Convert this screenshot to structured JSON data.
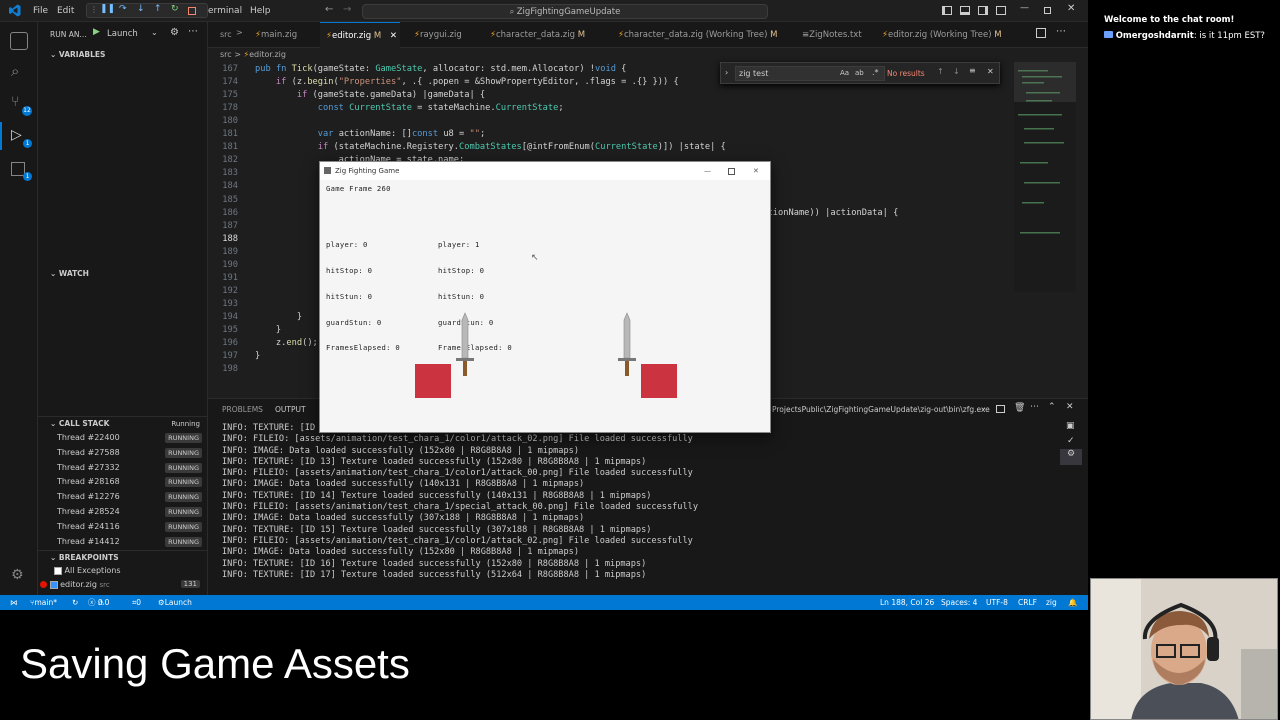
{
  "titlebar": {
    "menus": [
      "File",
      "Edit",
      "erminal",
      "Help"
    ],
    "search": "ZigFightingGameUpdate"
  },
  "sidebar": {
    "run_label": "RUN AN...",
    "launch_config": "Launch",
    "variables": "VARIABLES",
    "watch": "WATCH",
    "call_stack": "CALL STACK",
    "call_stack_status": "Running",
    "threads": [
      {
        "name": "Thread #22400",
        "state": "RUNNING"
      },
      {
        "name": "Thread #27588",
        "state": "RUNNING"
      },
      {
        "name": "Thread #27332",
        "state": "RUNNING"
      },
      {
        "name": "Thread #28168",
        "state": "RUNNING"
      },
      {
        "name": "Thread #12276",
        "state": "RUNNING"
      },
      {
        "name": "Thread #28524",
        "state": "RUNNING"
      },
      {
        "name": "Thread #24116",
        "state": "RUNNING"
      },
      {
        "name": "Thread #14412",
        "state": "RUNNING"
      }
    ],
    "breakpoints": "BREAKPOINTS",
    "all_exceptions": "All Exceptions",
    "bp_file": "editor.zig",
    "bp_folder": "src",
    "bp_line": "131"
  },
  "tabs": [
    {
      "label": "main.zig",
      "mod": ""
    },
    {
      "label": "editor.zig",
      "mod": "M"
    },
    {
      "label": "raygui.zig",
      "mod": ""
    },
    {
      "label": "character_data.zig",
      "mod": "M"
    },
    {
      "label": "character_data.zig (Working Tree)",
      "mod": "M"
    },
    {
      "label": "ZigNotes.txt",
      "mod": ""
    },
    {
      "label": "editor.zig (Working Tree)",
      "mod": "M"
    }
  ],
  "breadcrumb": {
    "folder": "src",
    "file": "editor.zig"
  },
  "find": {
    "query": "zig test",
    "result": "No results"
  },
  "editor": {
    "lines": [
      {
        "n": "167",
        "code": "pub fn Tick(gameState: GameState, allocator: std.mem.Allocator) !void {"
      },
      {
        "n": "174",
        "code": "    if (z.begin(\"Properties\", .{ .popen = &ShowPropertyEditor, .flags = .{} })) {"
      },
      {
        "n": "175",
        "code": "        if (gameState.gameData) |gameData| {"
      },
      {
        "n": "178",
        "code": "            const CurrentState = stateMachine.CurrentState;"
      },
      {
        "n": "180",
        "code": ""
      },
      {
        "n": "181",
        "code": "            var actionName: []const u8 = \"\";"
      },
      {
        "n": "181",
        "code": "            if (stateMachine.Registery.CombatStates[@intFromEnum(CurrentState)]) |state| {"
      },
      {
        "n": "182",
        "code": "                actionName = state.name;"
      },
      {
        "n": "183",
        "code": ""
      },
      {
        "n": "184",
        "code": ""
      },
      {
        "n": "185",
        "code": ""
      },
      {
        "n": "186",
        "code": "                                                                                   ems[entity], actionName)) |actionData| {"
      },
      {
        "n": "187",
        "code": ""
      },
      {
        "n": "188",
        "code": ""
      },
      {
        "n": "189",
        "code": ""
      },
      {
        "n": "190",
        "code": ""
      },
      {
        "n": "191",
        "code": ""
      },
      {
        "n": "192",
        "code": "                                                                                   llocator);"
      },
      {
        "n": "193",
        "code": ""
      },
      {
        "n": "194",
        "code": "        }"
      },
      {
        "n": "195",
        "code": "    }"
      },
      {
        "n": "196",
        "code": "    z.end();"
      },
      {
        "n": "197",
        "code": "}"
      },
      {
        "n": "198",
        "code": ""
      }
    ]
  },
  "panel": {
    "tabs": [
      "PROBLEMS",
      "OUTPUT"
    ],
    "path": "ProjectsPublic\\ZigFightingGameUpdate\\zig-out\\bin\\zfg.exe",
    "output": [
      "INFO: TEXTURE: [ID",
      "INFO: FILEIO: [assets/animation/test_chara_1/color1/attack_02.png] File loaded successfully",
      "INFO: IMAGE: Data loaded successfully (152x80 | R8G8B8A8 | 1 mipmaps)",
      "INFO: TEXTURE: [ID 13] Texture loaded successfully (152x80 | R8G8B8A8 | 1 mipmaps)",
      "INFO: FILEIO: [assets/animation/test_chara_1/color1/attack_00.png] File loaded successfully",
      "INFO: IMAGE: Data loaded successfully (140x131 | R8G8B8A8 | 1 mipmaps)",
      "INFO: TEXTURE: [ID 14] Texture loaded successfully (140x131 | R8G8B8A8 | 1 mipmaps)",
      "INFO: FILEIO: [assets/animation/test_chara_1/special_attack_00.png] File loaded successfully",
      "INFO: IMAGE: Data loaded successfully (307x188 | R8G8B8A8 | 1 mipmaps)",
      "INFO: TEXTURE: [ID 15] Texture loaded successfully (307x188 | R8G8B8A8 | 1 mipmaps)",
      "INFO: FILEIO: [assets/animation/test_chara_1/color1/attack_02.png] File loaded successfully",
      "INFO: IMAGE: Data loaded successfully (152x80 | R8G8B8A8 | 1 mipmaps)",
      "INFO: TEXTURE: [ID 16] Texture loaded successfully (152x80 | R8G8B8A8 | 1 mipmaps)",
      "INFO: TEXTURE: [ID 17] Texture loaded successfully (512x64 | R8G8B8A8 | 1 mipmaps)"
    ]
  },
  "statusbar": {
    "branch": "main*",
    "errors": "0",
    "warnings": "0",
    "ports": "0",
    "launch": "Launch (ZigFightingGameUpdate)",
    "position": "Ln 188, Col 26",
    "spaces": "Spaces: 4",
    "encoding": "UTF-8",
    "eol": "CRLF",
    "lang": "zig"
  },
  "game": {
    "title": "Zig Fighting Game",
    "frame": "Game Frame 260",
    "p1": [
      "player: 0",
      "hitStop: 0",
      "hitStun: 0",
      "guardStun: 0",
      "FramesElapsed: 0"
    ],
    "p2": [
      "player: 1",
      "hitStop: 0",
      "hitStun: 0",
      "guardStun: 0",
      "FramesElapsed: 0"
    ]
  },
  "chat": {
    "welcome": "Welcome to the chat room!",
    "user": "Omergoshdarnit",
    "message": ": is it 11pm EST?"
  },
  "caption": "Saving Game Assets",
  "colors": {
    "accent": "#0078d4",
    "fighter": "#cc3340",
    "editor_bg": "#1e1e1e"
  }
}
